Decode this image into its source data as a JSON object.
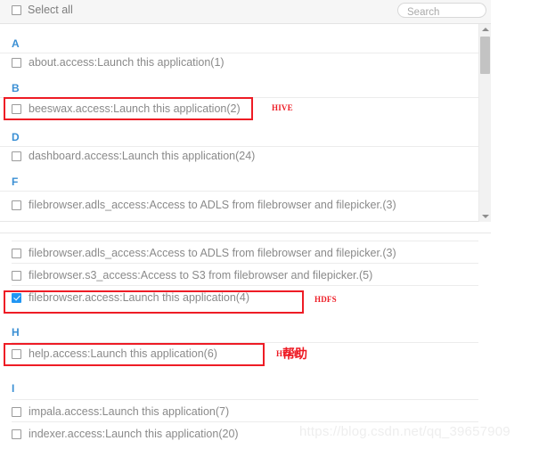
{
  "toolbar": {
    "select_all_label": "Select all",
    "select_all_checked": false,
    "search_placeholder": "Search",
    "search_value": ""
  },
  "colors": {
    "letter_header": "#3a8fd4",
    "checkbox_checked": "#2196f3",
    "annotation_red": "#ee1c25",
    "row_text": "#8a8a8a",
    "toolbar_bg": "#f6f6f6"
  },
  "top_panel": {
    "groups": [
      {
        "letter": "A",
        "items": [
          {
            "label": "about.access:Launch this application(1)",
            "checked": false
          }
        ]
      },
      {
        "letter": "B",
        "items": [
          {
            "label": "beeswax.access:Launch this application(2)",
            "checked": false
          }
        ]
      },
      {
        "letter": "D",
        "items": [
          {
            "label": "dashboard.access:Launch this application(24)",
            "checked": false
          }
        ]
      },
      {
        "letter": "F",
        "items": [
          {
            "label": "filebrowser.adls_access:Access to ADLS from filebrowser and filepicker.(3)",
            "checked": false
          }
        ]
      }
    ],
    "scrollbar": {
      "up_arrow": "chevron-up-icon",
      "down_arrow": "chevron-down-icon"
    }
  },
  "bottom_panel": {
    "rows": [
      {
        "type": "item",
        "label": "filebrowser.adls_access:Access to ADLS from filebrowser and filepicker.(3)",
        "checked": false
      },
      {
        "type": "item",
        "label": "filebrowser.s3_access:Access to S3 from filebrowser and filepicker.(5)",
        "checked": false
      },
      {
        "type": "item",
        "label": "filebrowser.access:Launch this application(4)",
        "checked": true
      },
      {
        "type": "letter",
        "label": "H"
      },
      {
        "type": "item",
        "label": "help.access:Launch this application(6)",
        "checked": false
      },
      {
        "type": "letter",
        "label": "I"
      },
      {
        "type": "item",
        "label": "impala.access:Launch this application(7)",
        "checked": false
      },
      {
        "type": "item",
        "label": "indexer.access:Launch this application(20)",
        "checked": false
      }
    ]
  },
  "annotations": [
    {
      "name": "hive-note",
      "text": "HIVE",
      "style": "small-caps"
    },
    {
      "name": "hdfs-note",
      "text": "HDFS",
      "style": "small-caps"
    },
    {
      "name": "help-note",
      "text": "HELP",
      "style": "small-caps"
    },
    {
      "name": "help-note-cjk",
      "text": "帮助",
      "style": "cjk"
    }
  ],
  "watermark": {
    "text": "https://blog.csdn.net/qq_39657909"
  }
}
